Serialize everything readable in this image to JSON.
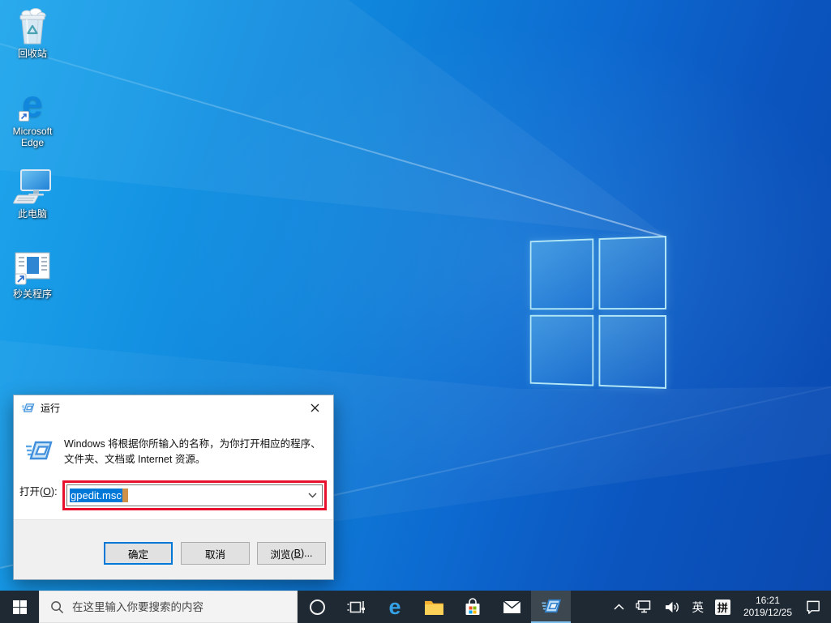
{
  "desktop": {
    "icons": [
      {
        "id": "recycle-bin",
        "label": "回收站"
      },
      {
        "id": "microsoft-edge",
        "label": "Microsoft Edge"
      },
      {
        "id": "this-pc",
        "label": "此电脑"
      },
      {
        "id": "shortcut-app",
        "label": "秒关程序"
      }
    ]
  },
  "run_dialog": {
    "title": "运行",
    "description_line1": "Windows 将根据你所输入的名称，为你打开相应的程序、",
    "description_line2": "文件夹、文档或 Internet 资源。",
    "open_label_pre": "打开(",
    "open_label_key": "O",
    "open_label_post": "):",
    "input_value": "gpedit.msc",
    "buttons": {
      "ok": "确定",
      "cancel": "取消",
      "browse_pre": "浏览(",
      "browse_key": "B",
      "browse_post": ")..."
    }
  },
  "taskbar": {
    "search_placeholder": "在这里输入你要搜索的内容",
    "tray": {
      "language": "英",
      "ime": "拼",
      "time": "16:21",
      "date": "2019/12/25"
    }
  },
  "icons": {
    "start": "windows-logo",
    "search": "magnifier",
    "cortana": "circle",
    "task_view": "timeline",
    "edge": "e-swoosh",
    "explorer": "folder",
    "store": "shopping-bag",
    "mail": "envelope",
    "run_app": "run-window",
    "hidden_icons": "chevron-up",
    "network": "ethernet-monitor",
    "volume": "speaker",
    "action_center": "speech-bubble",
    "close": "x-cross",
    "dropdown": "chevron-down"
  },
  "colors": {
    "taskbar": "#1e2933",
    "selection_blue": "#0078d7",
    "annotation_red": "#e8112d",
    "active_underline": "#7cc0f0",
    "wallpaper_light": "#1fa7ec",
    "wallpaper_dark": "#0a49b0"
  }
}
